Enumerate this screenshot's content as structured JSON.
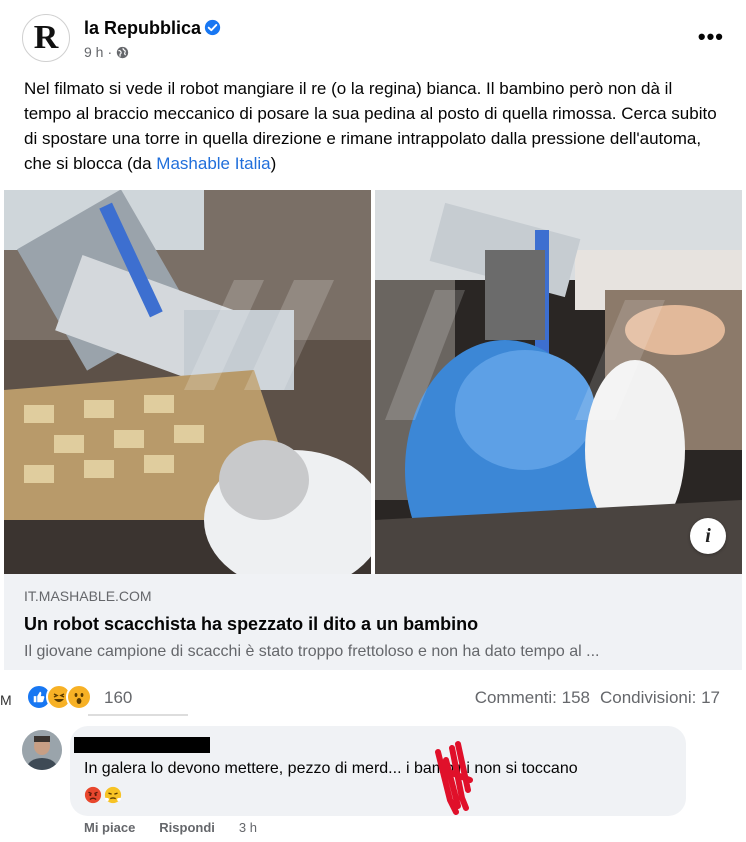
{
  "post": {
    "page_name": "la Repubblica",
    "avatar_letter": "R",
    "time": "9 h",
    "separator": "·",
    "text_main": "Nel filmato si vede il robot mangiare il re (o la regina) bianca. Il bambino però non dà il tempo al braccio meccanico di posare la sua pedina al posto di quella rimossa. Cerca subito di spostare una torre in quella direzione e rimane intrappolato dalla pressione dell'automa, che si blocca (da ",
    "text_link": "Mashable Italia",
    "text_end": ")",
    "icons": {
      "verified": "verified-badge-icon",
      "privacy": "globe-icon",
      "more": "more-options-icon",
      "info": "info-icon"
    },
    "more_label": "•••",
    "info_label": "i"
  },
  "link_preview": {
    "domain": "IT.MASHABLE.COM",
    "title": "Un robot scacchista ha spezzato il dito a un bambino",
    "description": "Il giovane campione di scacchi è stato troppo frettoloso e non ha dato tempo al ..."
  },
  "engagement": {
    "side_letter": "M",
    "reaction_count": "160",
    "reactions": [
      "like",
      "haha",
      "wow"
    ],
    "comments": "Commenti: 158",
    "shares": "Condivisioni: 17"
  },
  "comment": {
    "text": "In galera lo devono mettere, pezzo di merd... i bambini non si toccano",
    "emojis": [
      "angry-face",
      "steam-face"
    ],
    "actions": {
      "like": "Mi piace",
      "reply": "Rispondi",
      "time": "3 h"
    }
  },
  "colors": {
    "link": "#216fdb",
    "secondary_text": "#65676b",
    "like_blue": "#1877f2",
    "preview_bg": "#f0f2f5",
    "scribble_red": "#e0102a"
  }
}
